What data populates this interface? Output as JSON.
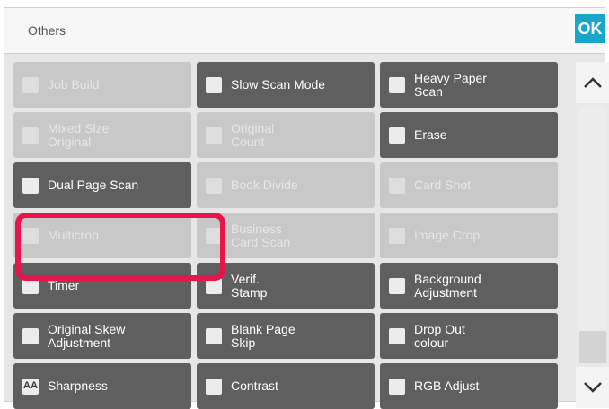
{
  "header": {
    "title": "Others",
    "ok_label": "OK"
  },
  "buttons": [
    {
      "label": "Job Build",
      "icon": "job-build-icon",
      "enabled": false
    },
    {
      "label": "Slow Scan Mode",
      "icon": "slow-scan-icon",
      "enabled": true
    },
    {
      "label": "Heavy Paper\nScan",
      "icon": "heavy-paper-icon",
      "enabled": true
    },
    {
      "label": "Mixed Size\nOriginal",
      "icon": "mixed-size-icon",
      "enabled": false
    },
    {
      "label": "Original\nCount",
      "icon": "original-count-icon",
      "enabled": false
    },
    {
      "label": "Erase",
      "icon": "erase-icon",
      "enabled": true
    },
    {
      "label": "Dual Page Scan",
      "icon": "dual-page-scan-icon",
      "enabled": true
    },
    {
      "label": "Book Divide",
      "icon": "book-divide-icon",
      "enabled": false
    },
    {
      "label": "Card Shot",
      "icon": "card-shot-icon",
      "enabled": false
    },
    {
      "label": "Multicrop",
      "icon": "multicrop-icon",
      "enabled": false
    },
    {
      "label": "Business\nCard Scan",
      "icon": "business-card-icon",
      "enabled": false
    },
    {
      "label": "Image Crop",
      "icon": "image-crop-icon",
      "enabled": false
    },
    {
      "label": "Timer",
      "icon": "timer-icon",
      "enabled": true
    },
    {
      "label": "Verif.\nStamp",
      "icon": "verif-stamp-icon",
      "enabled": true
    },
    {
      "label": "Background\nAdjustment",
      "icon": "background-adjust-icon",
      "enabled": true
    },
    {
      "label": "Original Skew\nAdjustment",
      "icon": "skew-adjust-icon",
      "enabled": true
    },
    {
      "label": "Blank Page\nSkip",
      "icon": "blank-page-icon",
      "enabled": true
    },
    {
      "label": "Drop Out\ncolour",
      "icon": "drop-out-icon",
      "enabled": true
    },
    {
      "label": "Sharpness",
      "icon": "sharpness-icon",
      "enabled": true
    },
    {
      "label": "Contrast",
      "icon": "contrast-icon",
      "enabled": true
    },
    {
      "label": "RGB Adjust",
      "icon": "rgb-adjust-icon",
      "enabled": true
    }
  ],
  "icon_glyphs": {
    "sharpness-icon": "AA"
  },
  "colors": {
    "enabled_button": "#5f5f5f",
    "disabled_button": "#c8c8c8",
    "highlight": "#e8144b",
    "ok_button": "#19a6c8"
  }
}
